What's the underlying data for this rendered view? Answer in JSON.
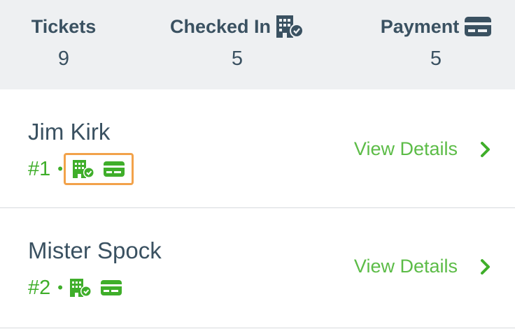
{
  "summary": {
    "tickets_label": "Tickets",
    "tickets_value": "9",
    "checked_in_label": "Checked In",
    "checked_in_value": "5",
    "payment_label": "Payment",
    "payment_value": "5"
  },
  "attendees": [
    {
      "name": "Jim Kirk",
      "number": "#1",
      "action_label": "View Details"
    },
    {
      "name": "Mister Spock",
      "number": "#2",
      "action_label": "View Details"
    }
  ],
  "separator": "•",
  "icons": {
    "checked_in": "building-check-icon",
    "payment": "credit-card-icon",
    "chevron": "chevron-right-icon"
  },
  "colors": {
    "header_bg": "#eef0f2",
    "text_dark": "#3a5161",
    "accent_green": "#3fae2a",
    "highlight_orange": "#f2a24a"
  }
}
